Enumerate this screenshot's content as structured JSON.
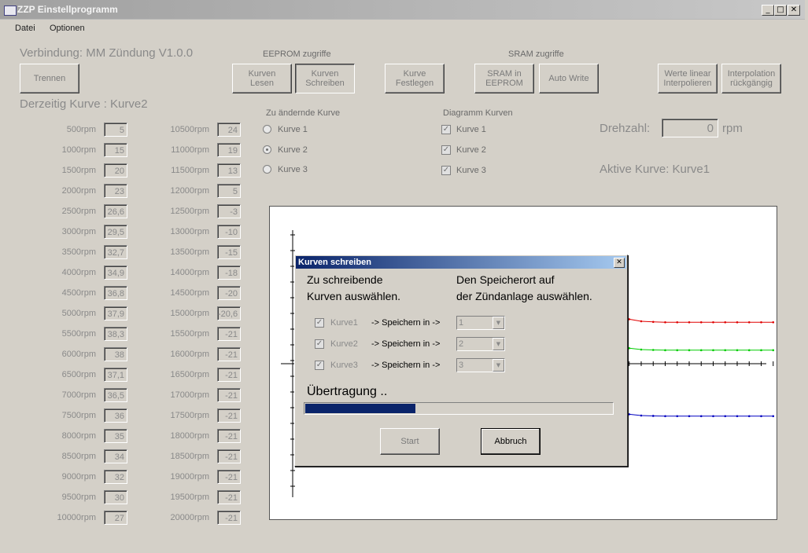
{
  "window": {
    "title": "ZZP Einstellprogramm",
    "min": "_",
    "max": "□",
    "close": "✕"
  },
  "menu": [
    "Datei",
    "Optionen"
  ],
  "status": {
    "connection": "Verbindung: MM Zündung V1.0.0",
    "current_curve": "Derzeitig Kurve : Kurve2",
    "speed_label": "Drehzahl:",
    "speed_value": "0",
    "speed_unit": "rpm",
    "active_curve": "Aktive Kurve: Kurve1"
  },
  "buttons": {
    "disconnect": "Trennen",
    "eeprom_group": "EEPROM zugriffe",
    "read": "Kurven\nLesen",
    "write": "Kurven\nSchreiben",
    "set_curve": "Kurve\nFestlegen",
    "sram_group": "SRAM zugriffe",
    "sram_to_eeprom": "SRAM  in\nEEPROM",
    "auto_write": "Auto Write",
    "interp_linear": "Werte linear\nInterpolieren",
    "interp_undo": "Interpolation\nrückgängig"
  },
  "curve_edit": {
    "title": "Zu ändernde Kurve",
    "options": [
      "Kurve 1",
      "Kurve 2",
      "Kurve 3"
    ],
    "selected": 1
  },
  "diagram": {
    "title": "Diagramm Kurven",
    "options": [
      "Kurve 1",
      "Kurve 2",
      "Kurve 3"
    ],
    "checked": [
      true,
      true,
      true
    ],
    "colors": {
      "kurve1": "#e00000",
      "kurve2": "#00cc00",
      "kurve3": "#0000c0"
    }
  },
  "table_left": [
    {
      "rpm": "500rpm",
      "val": "5"
    },
    {
      "rpm": "1000rpm",
      "val": "15"
    },
    {
      "rpm": "1500rpm",
      "val": "20"
    },
    {
      "rpm": "2000rpm",
      "val": "23"
    },
    {
      "rpm": "2500rpm",
      "val": "26,6"
    },
    {
      "rpm": "3000rpm",
      "val": "29,5"
    },
    {
      "rpm": "3500rpm",
      "val": "32,7"
    },
    {
      "rpm": "4000rpm",
      "val": "34,9"
    },
    {
      "rpm": "4500rpm",
      "val": "36,8"
    },
    {
      "rpm": "5000rpm",
      "val": "37,9"
    },
    {
      "rpm": "5500rpm",
      "val": "38,3"
    },
    {
      "rpm": "6000rpm",
      "val": "38"
    },
    {
      "rpm": "6500rpm",
      "val": "37,1"
    },
    {
      "rpm": "7000rpm",
      "val": "36,5"
    },
    {
      "rpm": "7500rpm",
      "val": "36"
    },
    {
      "rpm": "8000rpm",
      "val": "35"
    },
    {
      "rpm": "8500rpm",
      "val": "34"
    },
    {
      "rpm": "9000rpm",
      "val": "32"
    },
    {
      "rpm": "9500rpm",
      "val": "30"
    },
    {
      "rpm": "10000rpm",
      "val": "27"
    }
  ],
  "table_right": [
    {
      "rpm": "10500rpm",
      "val": "24"
    },
    {
      "rpm": "11000rpm",
      "val": "19"
    },
    {
      "rpm": "11500rpm",
      "val": "13"
    },
    {
      "rpm": "12000rpm",
      "val": "5"
    },
    {
      "rpm": "12500rpm",
      "val": "-3"
    },
    {
      "rpm": "13000rpm",
      "val": "-10"
    },
    {
      "rpm": "13500rpm",
      "val": "-15"
    },
    {
      "rpm": "14000rpm",
      "val": "-18"
    },
    {
      "rpm": "14500rpm",
      "val": "-20"
    },
    {
      "rpm": "15000rpm",
      "val": "-20,6"
    },
    {
      "rpm": "15500rpm",
      "val": "-21"
    },
    {
      "rpm": "16000rpm",
      "val": "-21"
    },
    {
      "rpm": "16500rpm",
      "val": "-21"
    },
    {
      "rpm": "17000rpm",
      "val": "-21"
    },
    {
      "rpm": "17500rpm",
      "val": "-21"
    },
    {
      "rpm": "18000rpm",
      "val": "-21"
    },
    {
      "rpm": "18500rpm",
      "val": "-21"
    },
    {
      "rpm": "19000rpm",
      "val": "-21"
    },
    {
      "rpm": "19500rpm",
      "val": "-21"
    },
    {
      "rpm": "20000rpm",
      "val": "-21"
    }
  ],
  "dialog": {
    "title": "Kurven schreiben",
    "left_text": "Zu schreibende\nKurven auswählen.",
    "right_text": "Den Speicherort auf\nder Zündanlage auswählen.",
    "rows": [
      {
        "label": "Kurve1",
        "arrow": "-> Speichern in ->",
        "slot": "1",
        "checked": true
      },
      {
        "label": "Kurve2",
        "arrow": "-> Speichern in ->",
        "slot": "2",
        "checked": true
      },
      {
        "label": "Kurve3",
        "arrow": "-> Speichern in ->",
        "slot": "3",
        "checked": true
      }
    ],
    "transfer_label": "Übertragung ..",
    "progress_fraction": 0.36,
    "start": "Start",
    "abort": "Abbruch"
  }
}
